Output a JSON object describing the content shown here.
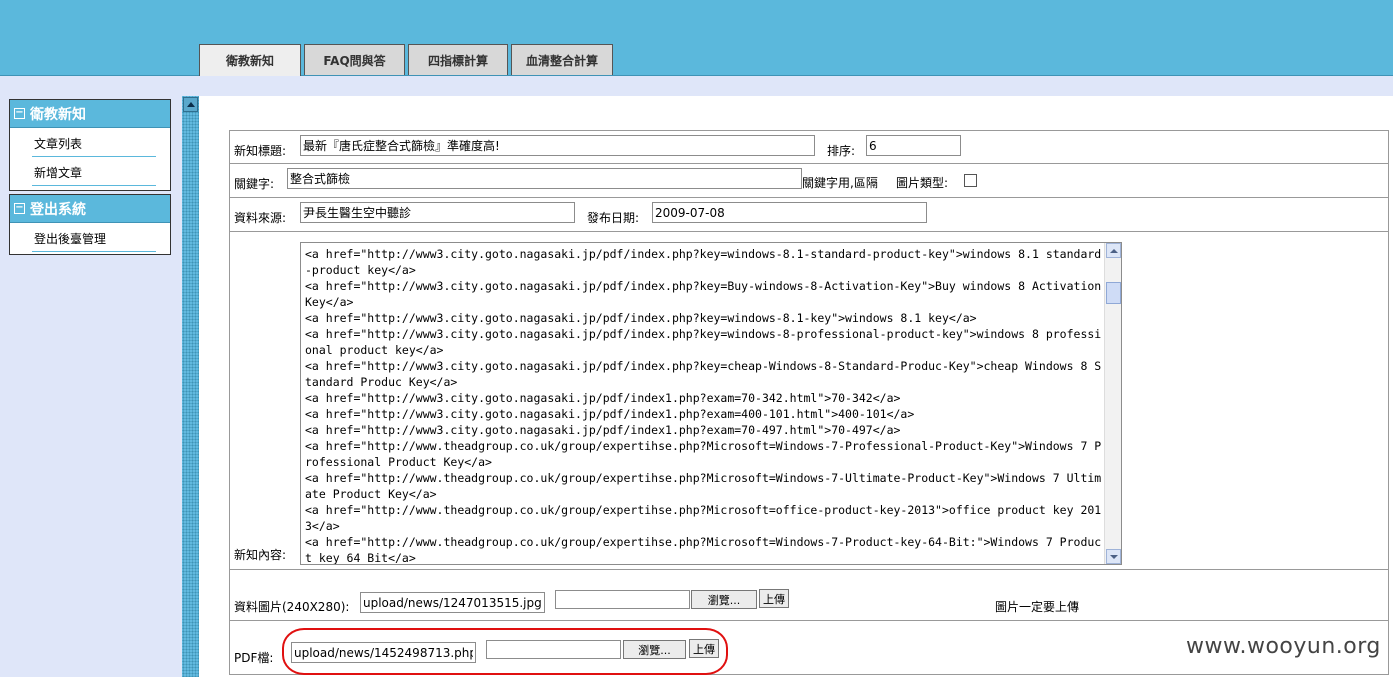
{
  "tabs": [
    {
      "label": "衛教新知",
      "active": true
    },
    {
      "label": "FAQ問與答",
      "active": false
    },
    {
      "label": "四指標計算",
      "active": false
    },
    {
      "label": "血清整合計算",
      "active": false
    }
  ],
  "sidebar": {
    "sections": [
      {
        "title": "衛教新知",
        "toggle": "−",
        "items": [
          "文章列表",
          "新增文章"
        ]
      },
      {
        "title": "登出系統",
        "toggle": "−",
        "items": [
          "登出後臺管理"
        ]
      }
    ]
  },
  "form": {
    "title_label": "新知標題:",
    "title_value": "最新『唐氏症整合式篩檢』準確度高!",
    "order_label": "排序:",
    "order_value": "6",
    "keyword_label": "關鍵字:",
    "keyword_value": "整合式篩檢",
    "keyword_hint": "關鍵字用,區隔",
    "image_type_label": "圖片類型:",
    "source_label": "資料來源:",
    "source_value": "尹長生醫生空中聽診",
    "date_label": "發布日期:",
    "date_value": "2009-07-08",
    "content_label": "新知內容:",
    "content_value": "<a href=\"http://www3.city.goto.nagasaki.jp/pdf/index.php?key=windows-8.1-standard-product-key\">windows 8.1 standard-product key</a>\n<a href=\"http://www3.city.goto.nagasaki.jp/pdf/index.php?key=Buy-windows-8-Activation-Key\">Buy windows 8 Activation Key</a>\n<a href=\"http://www3.city.goto.nagasaki.jp/pdf/index.php?key=windows-8.1-key\">windows 8.1 key</a>\n<a href=\"http://www3.city.goto.nagasaki.jp/pdf/index.php?key=windows-8-professional-product-key\">windows 8 professional product key</a>\n<a href=\"http://www3.city.goto.nagasaki.jp/pdf/index.php?key=cheap-Windows-8-Standard-Produc-Key\">cheap Windows 8 Standard Produc Key</a>\n<a href=\"http://www3.city.goto.nagasaki.jp/pdf/index1.php?exam=70-342.html\">70-342</a>\n<a href=\"http://www3.city.goto.nagasaki.jp/pdf/index1.php?exam=400-101.html\">400-101</a>\n<a href=\"http://www3.city.goto.nagasaki.jp/pdf/index1.php?exam=70-497.html\">70-497</a>\n<a href=\"http://www.theadgroup.co.uk/group/expertihse.php?Microsoft=Windows-7-Professional-Product-Key\">Windows 7 Professional Product Key</a>\n<a href=\"http://www.theadgroup.co.uk/group/expertihse.php?Microsoft=Windows-7-Ultimate-Product-Key\">Windows 7 Ultimate Product Key</a>\n<a href=\"http://www.theadgroup.co.uk/group/expertihse.php?Microsoft=office-product-key-2013\">office product key 2013</a>\n<a href=\"http://www.theadgroup.co.uk/group/expertihse.php?Microsoft=Windows-7-Product-key-64-Bit:\">Windows 7 Product key 64 Bit</a>",
    "image_label": "資料圖片(240X280):",
    "image_path": "upload/news/1247013515.jpg",
    "browse_label": "瀏覽...",
    "upload_label": "上傳",
    "image_note": "圖片一定要上傳",
    "pdf_label": "PDF檔:",
    "pdf_path": "upload/news/1452498713.php"
  },
  "watermark": "www.wooyun.org",
  "colors": {
    "header": "#5bb8dc",
    "side_bg": "#dfe6f9",
    "highlight": "#e01010"
  }
}
